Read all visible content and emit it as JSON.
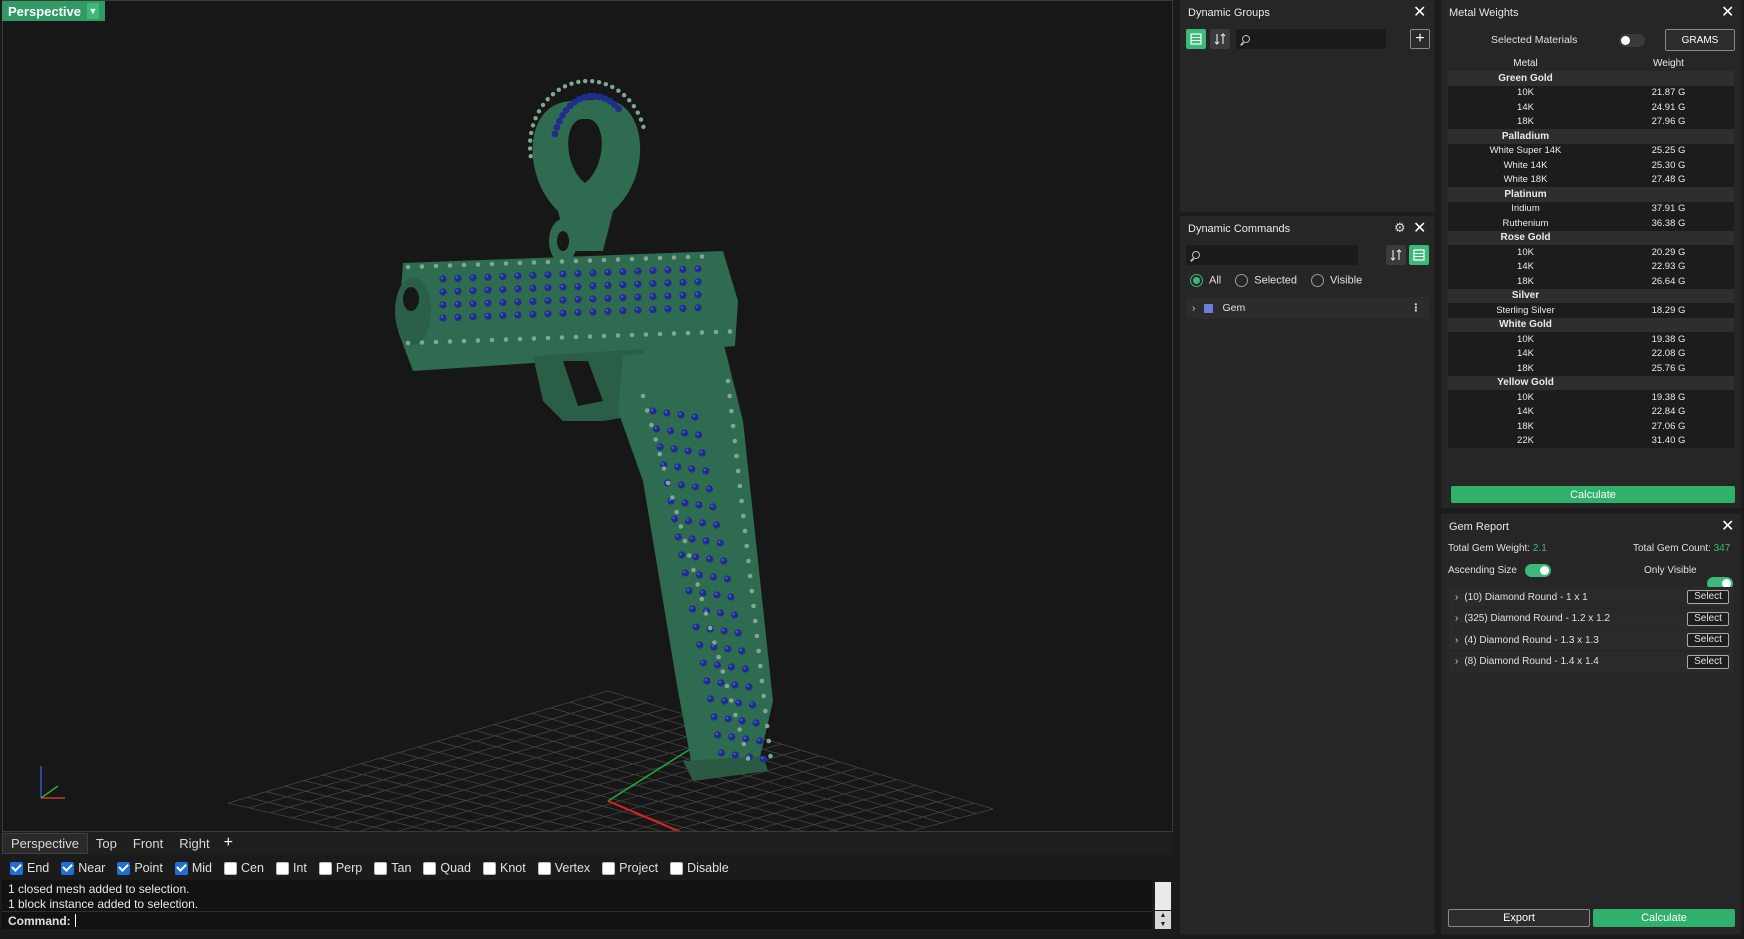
{
  "viewport": {
    "label": "Perspective",
    "tabs": [
      "Perspective",
      "Top",
      "Front",
      "Right"
    ],
    "add_tab": "+"
  },
  "osnaps": [
    {
      "label": "End",
      "checked": true
    },
    {
      "label": "Near",
      "checked": true
    },
    {
      "label": "Point",
      "checked": true
    },
    {
      "label": "Mid",
      "checked": true
    },
    {
      "label": "Cen",
      "checked": false
    },
    {
      "label": "Int",
      "checked": false
    },
    {
      "label": "Perp",
      "checked": false
    },
    {
      "label": "Tan",
      "checked": false
    },
    {
      "label": "Quad",
      "checked": false
    },
    {
      "label": "Knot",
      "checked": false
    },
    {
      "label": "Vertex",
      "checked": false
    },
    {
      "label": "Project",
      "checked": false
    },
    {
      "label": "Disable",
      "checked": false
    }
  ],
  "command": {
    "history": [
      "1 closed mesh added to selection.",
      "1 block instance added to selection."
    ],
    "prompt": "Command:"
  },
  "dynamic_groups": {
    "title": "Dynamic Groups",
    "add": "+"
  },
  "dynamic_commands": {
    "title": "Dynamic Commands",
    "filters": {
      "all": "All",
      "selected": "Selected",
      "visible": "Visible"
    },
    "items": [
      {
        "label": "Gem",
        "color": "#6c7fd8"
      }
    ]
  },
  "metal_weights": {
    "title": "Metal Weights",
    "selected_materials": "Selected Materials",
    "unit_button": "GRAMS",
    "col_metal": "Metal",
    "col_weight": "Weight",
    "groups": [
      {
        "name": "Green Gold",
        "rows": [
          [
            "10K",
            "21.87 G"
          ],
          [
            "14K",
            "24.91 G"
          ],
          [
            "18K",
            "27.96 G"
          ]
        ]
      },
      {
        "name": "Palladium",
        "rows": [
          [
            "White Super 14K",
            "25.25 G"
          ],
          [
            "White 14K",
            "25.30 G"
          ],
          [
            "White 18K",
            "27.48 G"
          ]
        ]
      },
      {
        "name": "Platinum",
        "rows": [
          [
            "Iridium",
            "37.91 G"
          ],
          [
            "Ruthenium",
            "36.38 G"
          ]
        ]
      },
      {
        "name": "Rose Gold",
        "rows": [
          [
            "10K",
            "20.29 G"
          ],
          [
            "14K",
            "22.93 G"
          ],
          [
            "18K",
            "26.64 G"
          ]
        ]
      },
      {
        "name": "Silver",
        "rows": [
          [
            "Sterling Silver",
            "18.29 G"
          ]
        ]
      },
      {
        "name": "White Gold",
        "rows": [
          [
            "10K",
            "19.38 G"
          ],
          [
            "14K",
            "22.08 G"
          ],
          [
            "18K",
            "25.76 G"
          ]
        ]
      },
      {
        "name": "Yellow Gold",
        "rows": [
          [
            "10K",
            "19.38 G"
          ],
          [
            "14K",
            "22.84 G"
          ],
          [
            "18K",
            "27.06 G"
          ],
          [
            "22K",
            "31.40 G"
          ]
        ]
      }
    ],
    "calculate": "Calculate"
  },
  "gem_report": {
    "title": "Gem Report",
    "total_weight_label": "Total Gem Weight:",
    "total_weight_value": "2.1",
    "total_count_label": "Total Gem Count:",
    "total_count_value": "347",
    "ascending_size": "Ascending Size",
    "only_visible": "Only Visible",
    "gems": [
      "(10) Diamond Round - 1 x 1",
      "(325) Diamond Round - 1.2 x 1.2",
      "(4) Diamond Round - 1.3 x 1.3",
      "(8) Diamond Round - 1.4 x 1.4"
    ],
    "select_label": "Select",
    "export": "Export",
    "calculate": "Calculate"
  },
  "colors": {
    "accent": "#3cb97a",
    "metal": "#2f6b50",
    "gem": "#2233a0"
  }
}
